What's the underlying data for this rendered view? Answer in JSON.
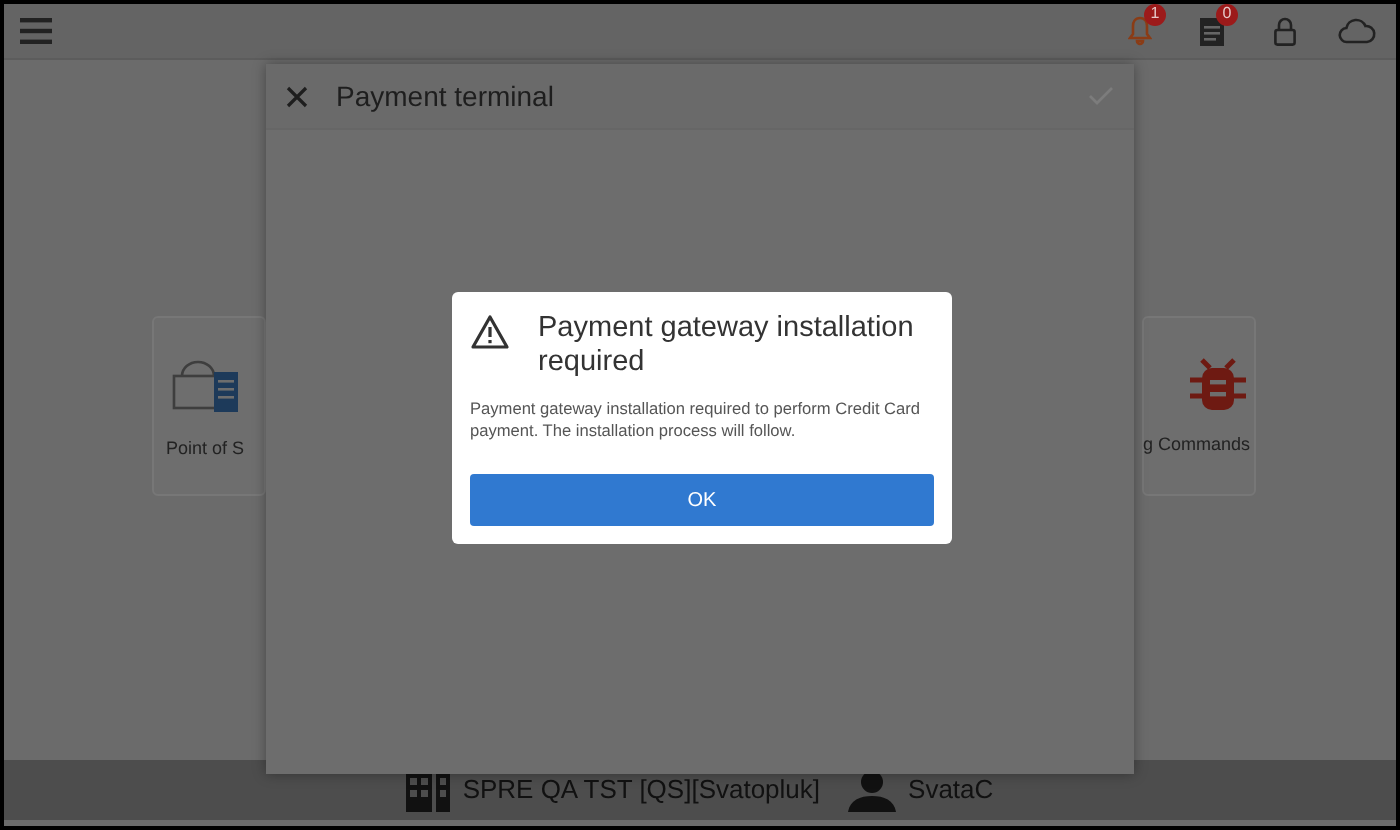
{
  "top_bar": {
    "notifications_badge": "1",
    "documents_badge": "0"
  },
  "tiles": [
    {
      "label": "Point of S",
      "kind": "pos"
    },
    {
      "label": "g Commands",
      "kind": "debug"
    }
  ],
  "panel": {
    "title": "Payment terminal"
  },
  "dialog": {
    "title": "Payment gateway installation required",
    "message": "Payment gateway installation required to perform Credit Card payment. The installation process will follow.",
    "button": "OK"
  },
  "footer": {
    "store": "SPRE QA TST [QS][Svatopluk]",
    "user": "SvataC"
  }
}
